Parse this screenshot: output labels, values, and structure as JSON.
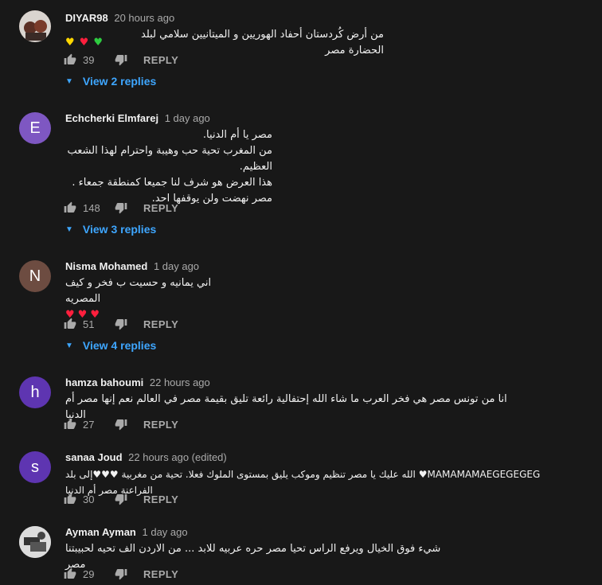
{
  "comments": [
    {
      "author": "DIYAR98",
      "time": "20 hours ago",
      "text_lines": [
        "من أرض كُردستان أحفاد الهوريين و الميتانيين سلامي لبلد الحضارة مصر"
      ],
      "emoji_suffix": [
        "yellow-heart",
        "red-heart",
        "green-heart"
      ],
      "likes": "39",
      "reply_label": "REPLY",
      "view_replies": "View 2 replies",
      "avatar_letter": "",
      "avatar_color": "#6b4a3a"
    },
    {
      "author": "Echcherki Elmfarej",
      "time": "1 day ago",
      "text_lines": [
        "مصر يا أم الدنيا.",
        "من المغرب تحية حب وهيبة واحترام لهذا الشعب العظيم.",
        "هذا العرض هو شرف لنا جميعا  كمنطقة جمعاء .",
        "مصر نهضت ولن يوقفها احد."
      ],
      "likes": "148",
      "reply_label": "REPLY",
      "view_replies": "View 3 replies",
      "avatar_letter": "E",
      "avatar_color": "#7e57c2"
    },
    {
      "author": "Nisma Mohamed",
      "time": "1 day ago",
      "text_lines": [
        "اني يمانيه و حسيت ب فخر و كيف المصريه"
      ],
      "hearts_count": 3,
      "likes": "51",
      "reply_label": "REPLY",
      "view_replies": "View 4 replies",
      "avatar_letter": "N",
      "avatar_color": "#6d4c41"
    },
    {
      "author": "hamza bahoumi",
      "time": "22 hours ago",
      "text_lines": [
        "انا من تونس مصر هي فخر العرب ما شاء الله إحتفالية رائعة تليق بقيمة مصر في العالم نعم إنها مصر أم الدنيا"
      ],
      "likes": "27",
      "reply_label": "REPLY",
      "avatar_letter": "h",
      "avatar_color": "#5e35b1"
    },
    {
      "author": "sanaa Joud",
      "time": "22 hours ago (edited)",
      "text_lines": [
        "MAMAMAMAEGEGEGEG♥ الله عليك يا مصر  تنظيم  وموكب يليق بمستوى الملوك فعلا. تحية من مغربية ♥♥♥إلى بلد الفراعنة مصر أم الدنيا"
      ],
      "likes": "30",
      "reply_label": "REPLY",
      "avatar_letter": "s",
      "avatar_color": "#5e35b1"
    },
    {
      "author": "Ayman Ayman",
      "time": "1 day ago",
      "text_lines": [
        "شيء فوق الخيال ويرفع الراس تحيا مصر حره عربيه للابد ... من الاردن الف تحيه لحبيبتنا مصر"
      ],
      "likes": "29",
      "reply_label": "REPLY",
      "avatar_letter": "",
      "avatar_color": "#9e9e9e"
    }
  ],
  "colors": {
    "background": "#181818",
    "link": "#3ea6ff",
    "muted": "#aaaaaa"
  }
}
